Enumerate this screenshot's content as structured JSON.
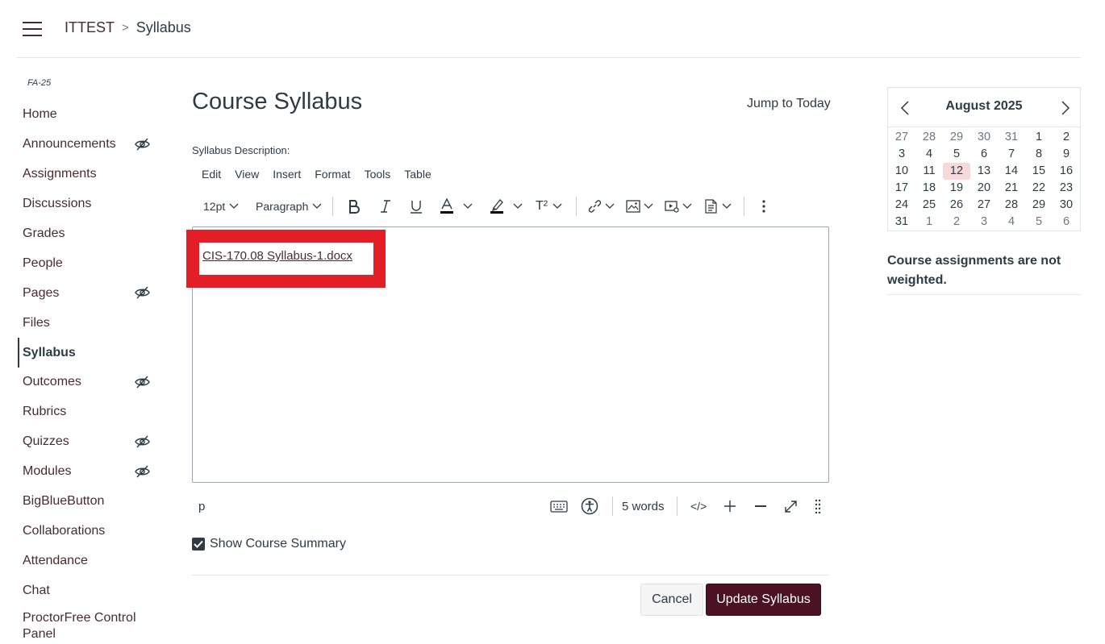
{
  "breadcrumb": {
    "course": "ITTEST",
    "separator": ">",
    "current": "Syllabus"
  },
  "sidebar": {
    "term": "FA-25",
    "items": [
      {
        "label": "Home",
        "hidden": false
      },
      {
        "label": "Announcements",
        "hidden": true
      },
      {
        "label": "Assignments",
        "hidden": false
      },
      {
        "label": "Discussions",
        "hidden": false
      },
      {
        "label": "Grades",
        "hidden": false
      },
      {
        "label": "People",
        "hidden": false
      },
      {
        "label": "Pages",
        "hidden": true
      },
      {
        "label": "Files",
        "hidden": false
      },
      {
        "label": "Syllabus",
        "hidden": false,
        "active": true
      },
      {
        "label": "Outcomes",
        "hidden": true
      },
      {
        "label": "Rubrics",
        "hidden": false
      },
      {
        "label": "Quizzes",
        "hidden": true
      },
      {
        "label": "Modules",
        "hidden": true
      },
      {
        "label": "BigBlueButton",
        "hidden": false
      },
      {
        "label": "Collaborations",
        "hidden": false
      },
      {
        "label": "Attendance",
        "hidden": false
      },
      {
        "label": "Chat",
        "hidden": false
      },
      {
        "label": "ProctorFree Control Panel",
        "hidden": false
      }
    ]
  },
  "main": {
    "title": "Course Syllabus",
    "jump_to_today": "Jump to Today",
    "description_label": "Syllabus Description:"
  },
  "editor": {
    "menus": [
      "Edit",
      "View",
      "Insert",
      "Format",
      "Tools",
      "Table"
    ],
    "font_size": "12pt",
    "block_format": "Paragraph",
    "superscript_label": "T²",
    "content_link": "CIS-170.08 Syllabus-1.docx",
    "status_element": "p",
    "word_count": "5 words",
    "html_toggle": "</>"
  },
  "summary": {
    "label": "Show Course Summary",
    "checked": true
  },
  "actions": {
    "cancel": "Cancel",
    "update": "Update Syllabus"
  },
  "calendar": {
    "month": "August 2025",
    "weeks": [
      [
        [
          "27",
          true
        ],
        [
          "28",
          true
        ],
        [
          "29",
          true
        ],
        [
          "30",
          true
        ],
        [
          "31",
          true
        ],
        [
          "1",
          false
        ],
        [
          "2",
          false
        ]
      ],
      [
        [
          "3",
          false
        ],
        [
          "4",
          false
        ],
        [
          "5",
          false
        ],
        [
          "6",
          false
        ],
        [
          "7",
          false
        ],
        [
          "8",
          false
        ],
        [
          "9",
          false
        ]
      ],
      [
        [
          "10",
          false
        ],
        [
          "11",
          false
        ],
        [
          "12",
          false
        ],
        [
          "13",
          false
        ],
        [
          "14",
          false
        ],
        [
          "15",
          false
        ],
        [
          "16",
          false
        ]
      ],
      [
        [
          "17",
          false
        ],
        [
          "18",
          false
        ],
        [
          "19",
          false
        ],
        [
          "20",
          false
        ],
        [
          "21",
          false
        ],
        [
          "22",
          false
        ],
        [
          "23",
          false
        ]
      ],
      [
        [
          "24",
          false
        ],
        [
          "25",
          false
        ],
        [
          "26",
          false
        ],
        [
          "27",
          false
        ],
        [
          "28",
          false
        ],
        [
          "29",
          false
        ],
        [
          "30",
          false
        ]
      ],
      [
        [
          "31",
          false
        ],
        [
          "1",
          true
        ],
        [
          "2",
          true
        ],
        [
          "3",
          true
        ],
        [
          "4",
          true
        ],
        [
          "5",
          true
        ],
        [
          "6",
          true
        ]
      ]
    ],
    "today": "12"
  },
  "weight_note": "Course assignments are not weighted.",
  "colors": {
    "brand": "#4a1222",
    "highlight": "#e41e26",
    "text": "#2d3b45"
  }
}
